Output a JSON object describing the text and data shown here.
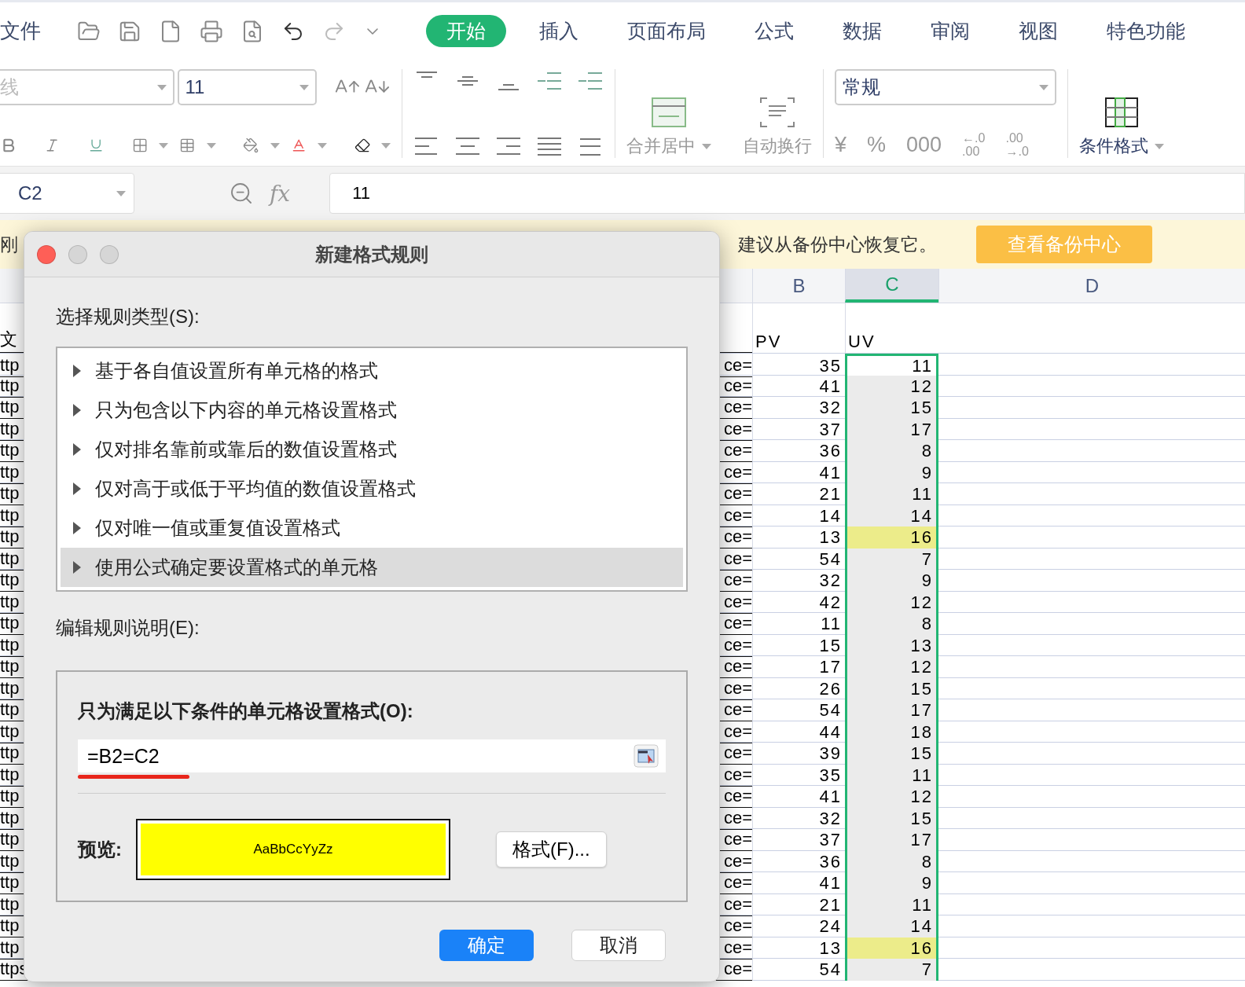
{
  "file_menu": "文件",
  "tabs": [
    {
      "label": "开始",
      "selected": true
    },
    {
      "label": "插入",
      "selected": false
    },
    {
      "label": "页面布局",
      "selected": false
    },
    {
      "label": "公式",
      "selected": false
    },
    {
      "label": "数据",
      "selected": false
    },
    {
      "label": "审阅",
      "selected": false
    },
    {
      "label": "视图",
      "selected": false
    },
    {
      "label": "特色功能",
      "selected": false
    }
  ],
  "font": {
    "name": "线",
    "size": "11"
  },
  "merge_label": "合并居中",
  "wrap_label": "自动换行",
  "number_format": "常规",
  "number_buttons": [
    "¥",
    "%",
    "000"
  ],
  "decimal_buttons": [
    {
      "top": "←.0",
      "bottom": ".00"
    },
    {
      "top": ".00",
      "bottom": "→.0"
    }
  ],
  "conditional_label": "条件格式",
  "formula_bar": {
    "cell": "C2",
    "fx": "fx",
    "value": "11"
  },
  "notice": {
    "lead": "刚",
    "message": "建议从备份中心恢复它。",
    "button": "查看备份中心"
  },
  "sheet": {
    "columns": [
      {
        "label": "B",
        "selected": false
      },
      {
        "label": "C",
        "selected": true
      },
      {
        "label": "D",
        "selected": false
      }
    ],
    "header_row": {
      "a": "文",
      "b": "PV",
      "c": "UV"
    },
    "rows": [
      {
        "a_left": "ttp",
        "a_right": "ce=",
        "pv": "35",
        "uv": "11",
        "highlighted": false,
        "active": true
      },
      {
        "a_left": "ttp",
        "a_right": "ce=",
        "pv": "41",
        "uv": "12",
        "highlighted": false,
        "active": false
      },
      {
        "a_left": "ttp",
        "a_right": "ce=",
        "pv": "32",
        "uv": "15",
        "highlighted": false,
        "active": false
      },
      {
        "a_left": "ttp",
        "a_right": "ce=",
        "pv": "37",
        "uv": "17",
        "highlighted": false,
        "active": false
      },
      {
        "a_left": "ttp",
        "a_right": "ce=",
        "pv": "36",
        "uv": "8",
        "highlighted": false,
        "active": false
      },
      {
        "a_left": "ttp",
        "a_right": "ce=",
        "pv": "41",
        "uv": "9",
        "highlighted": false,
        "active": false
      },
      {
        "a_left": "ttp",
        "a_right": "ce=",
        "pv": "21",
        "uv": "11",
        "highlighted": false,
        "active": false
      },
      {
        "a_left": "ttp",
        "a_right": "ce=",
        "pv": "14",
        "uv": "14",
        "highlighted": false,
        "active": false
      },
      {
        "a_left": "ttp",
        "a_right": "ce=",
        "pv": "13",
        "uv": "16",
        "highlighted": true,
        "active": false
      },
      {
        "a_left": "ttp",
        "a_right": "ce=",
        "pv": "54",
        "uv": "7",
        "highlighted": false,
        "active": false
      },
      {
        "a_left": "ttp",
        "a_right": "ce=",
        "pv": "32",
        "uv": "9",
        "highlighted": false,
        "active": false
      },
      {
        "a_left": "ttp",
        "a_right": "ce=",
        "pv": "42",
        "uv": "12",
        "highlighted": false,
        "active": false
      },
      {
        "a_left": "ttp",
        "a_right": "ce=",
        "pv": "11",
        "uv": "8",
        "highlighted": false,
        "active": false
      },
      {
        "a_left": "ttp",
        "a_right": "ce=",
        "pv": "15",
        "uv": "13",
        "highlighted": false,
        "active": false
      },
      {
        "a_left": "ttp",
        "a_right": "ce=",
        "pv": "17",
        "uv": "12",
        "highlighted": false,
        "active": false
      },
      {
        "a_left": "ttp",
        "a_right": "ce=",
        "pv": "26",
        "uv": "15",
        "highlighted": false,
        "active": false
      },
      {
        "a_left": "ttp",
        "a_right": "ce=",
        "pv": "54",
        "uv": "17",
        "highlighted": false,
        "active": false
      },
      {
        "a_left": "ttp",
        "a_right": "ce=",
        "pv": "44",
        "uv": "18",
        "highlighted": false,
        "active": false
      },
      {
        "a_left": "ttp",
        "a_right": "ce=",
        "pv": "39",
        "uv": "15",
        "highlighted": false,
        "active": false
      },
      {
        "a_left": "ttp",
        "a_right": "ce=",
        "pv": "35",
        "uv": "11",
        "highlighted": false,
        "active": false
      },
      {
        "a_left": "ttp",
        "a_right": "ce=",
        "pv": "41",
        "uv": "12",
        "highlighted": false,
        "active": false
      },
      {
        "a_left": "ttp",
        "a_right": "ce=",
        "pv": "32",
        "uv": "15",
        "highlighted": false,
        "active": false
      },
      {
        "a_left": "ttp",
        "a_right": "ce=",
        "pv": "37",
        "uv": "17",
        "highlighted": false,
        "active": false
      },
      {
        "a_left": "ttp",
        "a_right": "ce=",
        "pv": "36",
        "uv": "8",
        "highlighted": false,
        "active": false
      },
      {
        "a_left": "ttp",
        "a_right": "ce=",
        "pv": "41",
        "uv": "9",
        "highlighted": false,
        "active": false
      },
      {
        "a_left": "ttp",
        "a_right": "ce=",
        "pv": "21",
        "uv": "11",
        "highlighted": false,
        "active": false
      },
      {
        "a_left": "ttp",
        "a_right": "ce=",
        "pv": "24",
        "uv": "14",
        "highlighted": false,
        "active": false
      },
      {
        "a_left": "ttp",
        "a_right": "ce=",
        "pv": "13",
        "uv": "16",
        "highlighted": true,
        "active": false
      },
      {
        "a_left": "ttps",
        "a_right": "ce=",
        "pv": "54",
        "uv": "7",
        "highlighted": false,
        "active": false
      }
    ]
  },
  "dialog": {
    "title": "新建格式规则",
    "type_label": "选择规则类型(S):",
    "rule_types": [
      {
        "label": "基于各自值设置所有单元格的格式",
        "selected": false
      },
      {
        "label": "只为包含以下内容的单元格设置格式",
        "selected": false
      },
      {
        "label": "仅对排名靠前或靠后的数值设置格式",
        "selected": false
      },
      {
        "label": "仅对高于或低于平均值的数值设置格式",
        "selected": false
      },
      {
        "label": "仅对唯一值或重复值设置格式",
        "selected": false
      },
      {
        "label": "使用公式确定要设置格式的单元格",
        "selected": true
      }
    ],
    "edit_label": "编辑规则说明(E):",
    "condition_label": "只为满足以下条件的单元格设置格式(O):",
    "formula": "=B2=C2",
    "preview_label": "预览:",
    "preview_text": "AaBbCcYyZz",
    "format_button": "格式(F)...",
    "buttons": [
      {
        "label": "确定",
        "kind": "primary"
      },
      {
        "label": "取消",
        "kind": "secondary"
      }
    ]
  }
}
